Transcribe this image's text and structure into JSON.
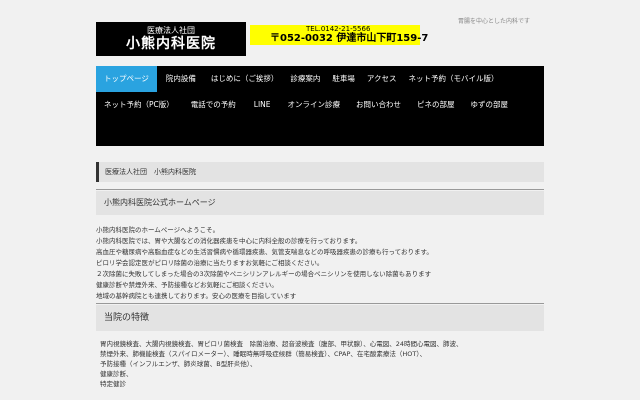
{
  "header": {
    "logo_line1": "医療法人社団",
    "logo_line2": "小熊内科医院",
    "tel": "TEL.0142-21-5566",
    "address": "〒052-0032 伊達市山下町159-7",
    "tagline": "胃腸を中心とした内科です"
  },
  "nav": {
    "row1": [
      "トップページ",
      "院内設備",
      "はじめに（ご挨拶）",
      "診療案内",
      "駐車場",
      "アクセス",
      "ネット予約（モバイル版）"
    ],
    "row2": [
      "ネット予約（PC版）",
      "電話での予約",
      "LINE",
      "オンライン診療",
      "お問い合わせ",
      "ピネの部屋",
      "ゆずの部屋"
    ]
  },
  "breadcrumb": "医療法人社団　小熊内科医院",
  "section1_title": "小熊内科医院公式ホームページ",
  "intro": [
    "小熊内科医院のホームページへようこそ。",
    "小熊内科医院では、胃や大腸などの消化器疾患を中心に内科全般の診療を行っております。",
    "高血圧や糖尿病や高脂血症などの生活習慣病や循環器疾患、気管支喘息などの呼吸器疾患の診療も行っております。",
    "ピロリ学会認定医がピロリ除菌の治療に当たりますお気軽にご相談ください。",
    "２次除菌に失敗してしまった場合の3次除菌やペニシリンアレルギーの場合ペニシリンを使用しない除菌もあります",
    "健康診断や禁煙外来、予防接種などお気軽にご相談ください。",
    "地域の基幹病院とも連携しております。安心の医療を目指しています"
  ],
  "section2_title": "当院の特徴",
  "features": [
    "胃内視鏡検査、大腸内視鏡検査、胃ピロリ菌検査　除菌治療、超音波検査（腹部、甲状腺）、心電図、24時間心電図、肺波、",
    "禁煙外来、肺機能検査（スパイロメーター）、睡眠時無呼吸症候群（簡易検査）、CPAP、在宅酸素療法（HOT）、",
    "予防接種（インフルエンザ、肺炎球菌、B型肝炎他）、",
    "健康診断、",
    "特定健診"
  ]
}
